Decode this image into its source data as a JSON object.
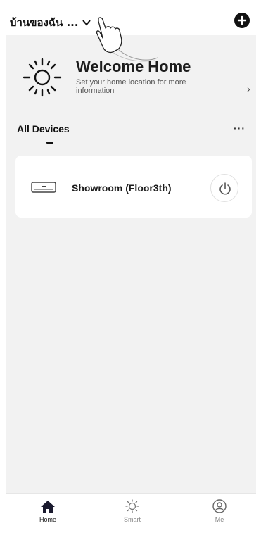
{
  "header": {
    "home_name": "บ้านของฉัน ..."
  },
  "welcome": {
    "title": "Welcome Home",
    "subtitle": "Set your home location for more information",
    "arrow": "›"
  },
  "devices": {
    "section_title": "All Devices",
    "more_label": "···",
    "items": [
      {
        "name": "Showroom (Floor3th)",
        "icon": "air-conditioner-icon"
      }
    ]
  },
  "bottom_nav": {
    "items": [
      {
        "label": "Home",
        "icon": "home-icon",
        "active": true
      },
      {
        "label": "Smart",
        "icon": "sun-icon",
        "active": false
      },
      {
        "label": "Me",
        "icon": "profile-icon",
        "active": false
      }
    ]
  },
  "colors": {
    "background": "#f2f2f2",
    "card": "#ffffff",
    "accent_dark": "#121212"
  }
}
